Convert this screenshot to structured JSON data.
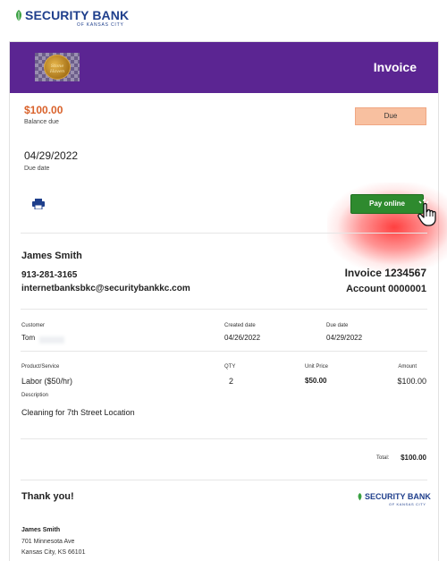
{
  "bank": {
    "name": "SECURITY BANK",
    "sub": "OF KANSAS CITY"
  },
  "merchant": {
    "logo_text": "Stone Haven"
  },
  "header": {
    "title": "Invoice"
  },
  "summary": {
    "balance_amount": "$100.00",
    "balance_label": "Balance due",
    "status": "Due",
    "due_date": "04/29/2022",
    "due_date_label": "Due date",
    "pay_button": "Pay online"
  },
  "billing": {
    "name": "James Smith",
    "phone": "913-281-3165",
    "email": "internetbanksbkc@securitybankkc.com",
    "invoice_number": "Invoice 1234567",
    "account_number": "Account 0000001"
  },
  "details": {
    "customer_label": "Customer",
    "customer_value": "Tom",
    "created_label": "Created date",
    "created_value": "04/26/2022",
    "due_label": "Due date",
    "due_value": "04/29/2022"
  },
  "line_items": {
    "headers": {
      "product": "Product/Service",
      "qty": "QTY",
      "unit_price": "Unit Price",
      "amount": "Amount"
    },
    "rows": [
      {
        "product": "Labor ($50/hr)",
        "qty": "2",
        "unit_price": "$50.00",
        "amount": "$100.00"
      }
    ],
    "description_label": "Description",
    "description_value": "Cleaning for 7th Street Location"
  },
  "total": {
    "label": "Total:",
    "value": "$100.00"
  },
  "footer": {
    "thanks": "Thank you!",
    "name": "James Smith",
    "address1": "701 Minnesota Ave",
    "address2": "Kansas City, KS 66101"
  },
  "colors": {
    "header_bg": "#5b2592",
    "balance": "#d9622b",
    "due_badge": "#f8c0a0",
    "pay_button": "#2e8a2e",
    "bank_blue": "#1f3f8c",
    "bank_green": "#3aa142"
  }
}
